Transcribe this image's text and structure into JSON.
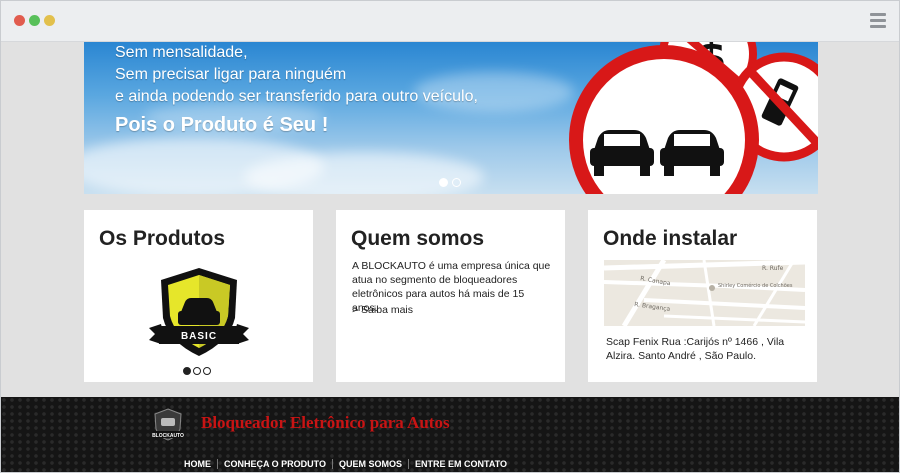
{
  "window": {
    "controls": [
      "close",
      "minimize",
      "maximize"
    ],
    "menu_icon": "hamburger-icon"
  },
  "hero": {
    "lines": [
      "Sem mensalidade,",
      "Sem precisar ligar para ninguém",
      "e ainda podendo ser transferido para outro veículo,"
    ],
    "highlight": "Pois o Produto é Seu !",
    "slides": 2,
    "active_slide": 1
  },
  "products": {
    "title": "Os Produtos",
    "badge_label": "BASIC",
    "slides": 3,
    "active_slide": 1
  },
  "about": {
    "title": "Quem somos",
    "description": "A BLOCKAUTO é uma empresa única que atua no segmento de bloqueadores eletrônicos para autos há mais de 15 anos.",
    "more_link": "> Saiba mais"
  },
  "location": {
    "title": "Onde instalar",
    "map_labels": [
      "R. Rufe",
      "R. Canapa",
      "Shirley Comércio de Colchões",
      "R. Bragança"
    ],
    "address": "Scap Fenix Rua :Carijós nº 1466 , Vila Alzira. Santo André , São Paulo."
  },
  "footer": {
    "logo_text": "BLOCKAUTO",
    "title": "Bloqueador Eletrônico para Autos",
    "nav": [
      "HOME",
      "CONHEÇA O PRODUTO",
      "QUEM SOMOS",
      "ENTRE EM CONTATO"
    ]
  },
  "colors": {
    "accent_red": "#c81414",
    "footer_bg": "#151515"
  }
}
